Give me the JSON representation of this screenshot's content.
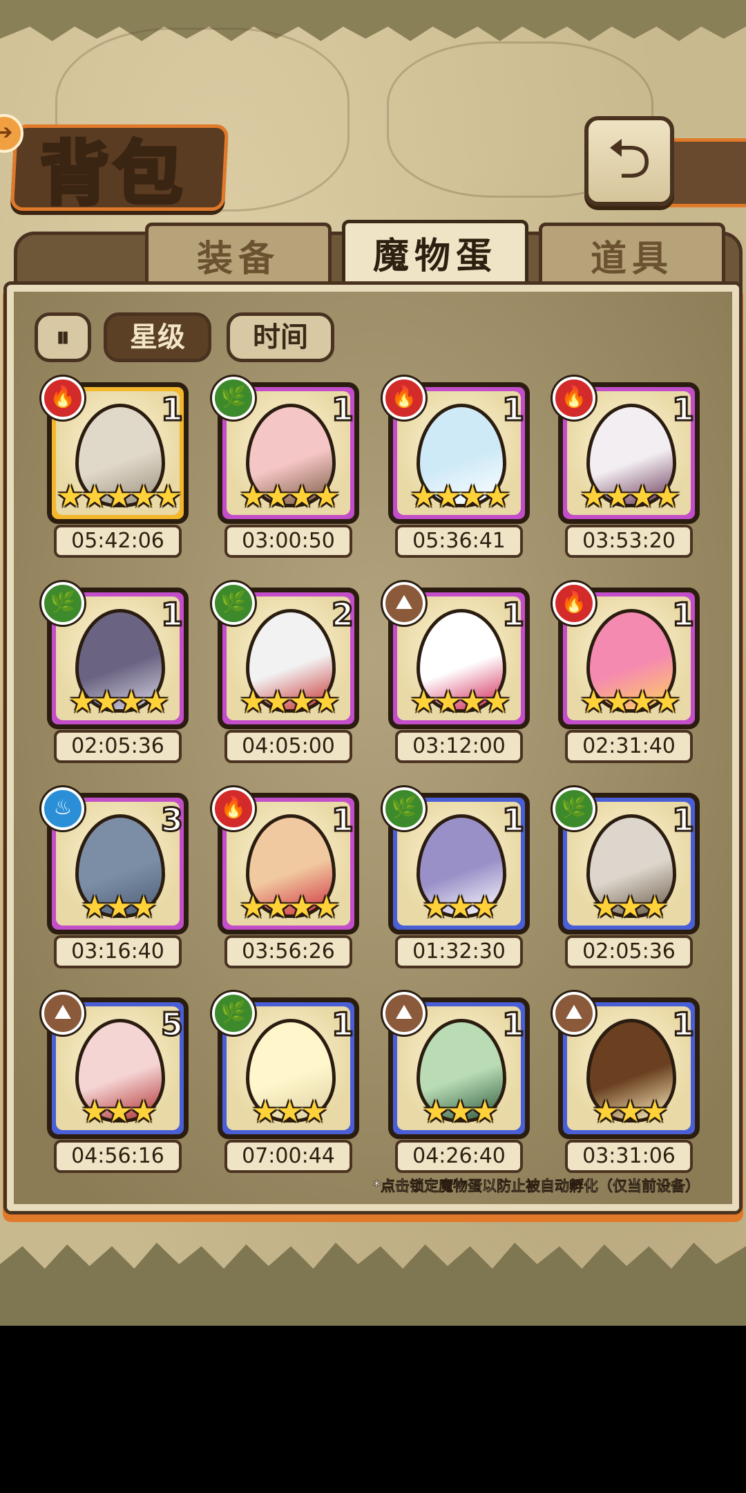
{
  "header": {
    "title": "背包",
    "return_icon": "return-arrow-icon",
    "back_icon": "back-arrow-icon"
  },
  "tabs": [
    {
      "label": "装备",
      "active": false
    },
    {
      "label": "魔物蛋",
      "active": true
    },
    {
      "label": "道具",
      "active": false
    }
  ],
  "sort": {
    "toggle_icon": "sort-order-icon",
    "options": [
      {
        "label": "星级",
        "selected": true
      },
      {
        "label": "时间",
        "selected": false
      }
    ]
  },
  "colors": {
    "gold": "#f3b72b",
    "purple": "#c24fc9",
    "blue": "#4a5fd6",
    "fire": "#d32a2a",
    "nature": "#3d8a2c",
    "water": "#2a8fd6",
    "earth": "#8a5a3a"
  },
  "eggs": [
    {
      "time": "05:42:06",
      "count": "1",
      "stars": 5,
      "rarity": "gold",
      "element": "fire",
      "egg": "battleship"
    },
    {
      "time": "03:00:50",
      "count": "1",
      "stars": 4,
      "rarity": "purple",
      "element": "nature",
      "egg": "pink-pig"
    },
    {
      "time": "05:36:41",
      "count": "1",
      "stars": 4,
      "rarity": "purple",
      "element": "fire",
      "egg": "ice-crystal"
    },
    {
      "time": "03:53:20",
      "count": "1",
      "stars": 4,
      "rarity": "purple",
      "element": "fire",
      "egg": "bat-wing"
    },
    {
      "time": "02:05:36",
      "count": "1",
      "stars": 4,
      "rarity": "purple",
      "element": "nature",
      "egg": "spiked-collar-dark"
    },
    {
      "time": "04:05:00",
      "count": "2",
      "stars": 4,
      "rarity": "purple",
      "element": "nature",
      "egg": "turret"
    },
    {
      "time": "03:12:00",
      "count": "1",
      "stars": 4,
      "rarity": "purple",
      "element": "earth",
      "egg": "cracked-bow"
    },
    {
      "time": "02:31:40",
      "count": "1",
      "stars": 4,
      "rarity": "purple",
      "element": "fire",
      "egg": "crowned-pink"
    },
    {
      "time": "03:16:40",
      "count": "3",
      "stars": 3,
      "rarity": "purple",
      "element": "water",
      "egg": "warship"
    },
    {
      "time": "03:56:26",
      "count": "1",
      "stars": 4,
      "rarity": "purple",
      "element": "fire",
      "egg": "kimono"
    },
    {
      "time": "01:32:30",
      "count": "1",
      "stars": 3,
      "rarity": "blue",
      "element": "nature",
      "egg": "iridescent"
    },
    {
      "time": "02:05:36",
      "count": "1",
      "stars": 3,
      "rarity": "blue",
      "element": "nature",
      "egg": "spiked-collar-light"
    },
    {
      "time": "04:56:16",
      "count": "5",
      "stars": 3,
      "rarity": "blue",
      "element": "earth",
      "egg": "ribbon-pink"
    },
    {
      "time": "07:00:44",
      "count": "1",
      "stars": 3,
      "rarity": "blue",
      "element": "nature",
      "egg": "lotus"
    },
    {
      "time": "04:26:40",
      "count": "1",
      "stars": 3,
      "rarity": "blue",
      "element": "earth",
      "egg": "green-cloak"
    },
    {
      "time": "03:31:06",
      "count": "1",
      "stars": 3,
      "rarity": "blue",
      "element": "earth",
      "egg": "bear-basket"
    }
  ],
  "footnote": "*点击锁定魔物蛋以防止被自动孵化（仅当前设备）"
}
